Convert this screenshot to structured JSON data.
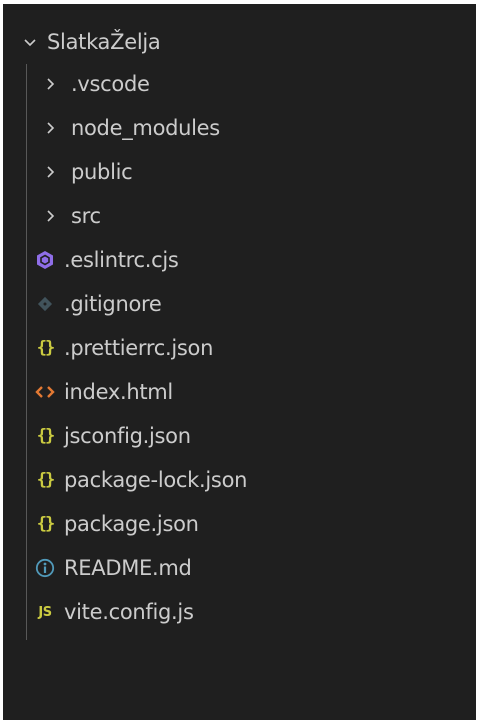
{
  "explorer": {
    "root": {
      "label": "SlatkaŽelja",
      "icon": "chevron-down-icon"
    },
    "folders": [
      {
        "label": ".vscode",
        "icon": "chevron-right-icon"
      },
      {
        "label": "node_modules",
        "icon": "chevron-right-icon"
      },
      {
        "label": "public",
        "icon": "chevron-right-icon"
      },
      {
        "label": "src",
        "icon": "chevron-right-icon"
      }
    ],
    "files": [
      {
        "label": ".eslintrc.cjs",
        "icon": "eslint-icon",
        "color": "#8f6ee8"
      },
      {
        "label": ".gitignore",
        "icon": "git-icon",
        "color": "#41535b"
      },
      {
        "label": ".prettierrc.json",
        "icon": "json-icon",
        "color": "#cbcb41"
      },
      {
        "label": "index.html",
        "icon": "html-icon",
        "color": "#e37933"
      },
      {
        "label": "jsconfig.json",
        "icon": "json-icon",
        "color": "#cbcb41"
      },
      {
        "label": "package-lock.json",
        "icon": "json-icon",
        "color": "#cbcb41"
      },
      {
        "label": "package.json",
        "icon": "json-icon",
        "color": "#cbcb41"
      },
      {
        "label": "README.md",
        "icon": "info-icon",
        "color": "#519aba"
      },
      {
        "label": "vite.config.js",
        "icon": "js-icon",
        "color": "#cbcb41",
        "badge": "JS"
      }
    ]
  },
  "colors": {
    "background": "#1f1f1f",
    "text": "#cccccc",
    "indent_guide": "#585858"
  }
}
